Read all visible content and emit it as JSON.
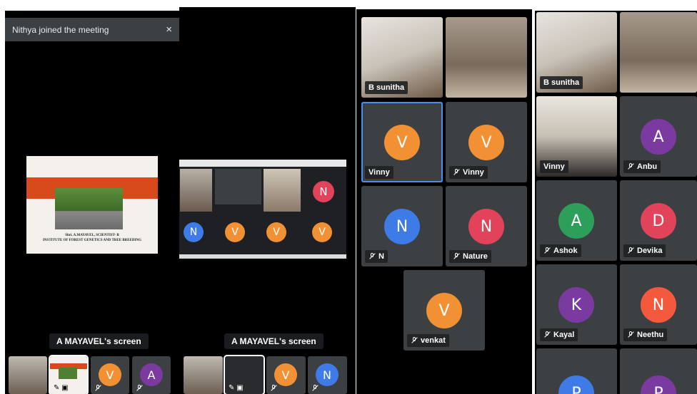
{
  "toast": {
    "message": "Nithya joined the meeting",
    "close_icon": "×"
  },
  "screen_share_label": "A MAYAVEL's screen",
  "slide": {
    "line1": "Shri. A.MAYAVEL, SCIENTIST- B",
    "line2": "INSTITUTE OF FOREST GENETICS AND TREE BREEDING"
  },
  "colors": {
    "orange": "#f29134",
    "purple": "#7b3aa0",
    "blue": "#3e7be6",
    "red": "#e0435a",
    "green": "#2e9e5b",
    "select": "#4a8ff0"
  },
  "panel1_strip": [
    {
      "kind": "photo"
    },
    {
      "kind": "slide"
    },
    {
      "kind": "avatar",
      "letter": "V",
      "color": "#f29134"
    },
    {
      "kind": "avatar",
      "letter": "A",
      "color": "#7b3aa0"
    }
  ],
  "panel2_strip": [
    {
      "kind": "photo"
    },
    {
      "kind": "screen"
    },
    {
      "kind": "avatar",
      "letter": "V",
      "color": "#f29134"
    },
    {
      "kind": "avatar",
      "letter": "N",
      "color": "#3e7be6"
    }
  ],
  "panel3": {
    "tiles": [
      {
        "name": "B sunitha",
        "kind": "photo",
        "muted": false
      },
      {
        "name": "",
        "kind": "photo2",
        "muted": false
      },
      {
        "name": "Vinny",
        "letter": "V",
        "color": "#f29134",
        "muted": false,
        "selected": true
      },
      {
        "name": "Vinny",
        "letter": "V",
        "color": "#f29134",
        "muted": true
      },
      {
        "name": "N",
        "letter": "N",
        "color": "#3e7be6",
        "muted": true
      },
      {
        "name": "Nature",
        "letter": "N",
        "color": "#e0435a",
        "muted": true
      },
      {
        "name": "venkat",
        "letter": "V",
        "color": "#f29134",
        "muted": true
      }
    ]
  },
  "panel4": {
    "tiles": [
      {
        "name": "B sunitha",
        "kind": "photo",
        "muted": false,
        "selected": true
      },
      {
        "name": "",
        "kind": "photo2",
        "muted": false
      },
      {
        "name": "Vinny",
        "kind": "photo3",
        "muted": false
      },
      {
        "name": "Anbu",
        "letter": "A",
        "color": "#7b3aa0",
        "muted": true
      },
      {
        "name": "Ashok",
        "letter": "A",
        "color": "#2e9e5b",
        "muted": true
      },
      {
        "name": "Devika",
        "letter": "D",
        "color": "#e0435a",
        "muted": true
      },
      {
        "name": "Kayal",
        "letter": "K",
        "color": "#7b3aa0",
        "muted": true
      },
      {
        "name": "Neethu",
        "letter": "N",
        "color": "#f5593d",
        "muted": true
      },
      {
        "name": "",
        "letter": "P",
        "color": "#3e7be6",
        "muted": false
      },
      {
        "name": "",
        "letter": "P",
        "color": "#7b3aa0",
        "muted": false
      }
    ]
  }
}
